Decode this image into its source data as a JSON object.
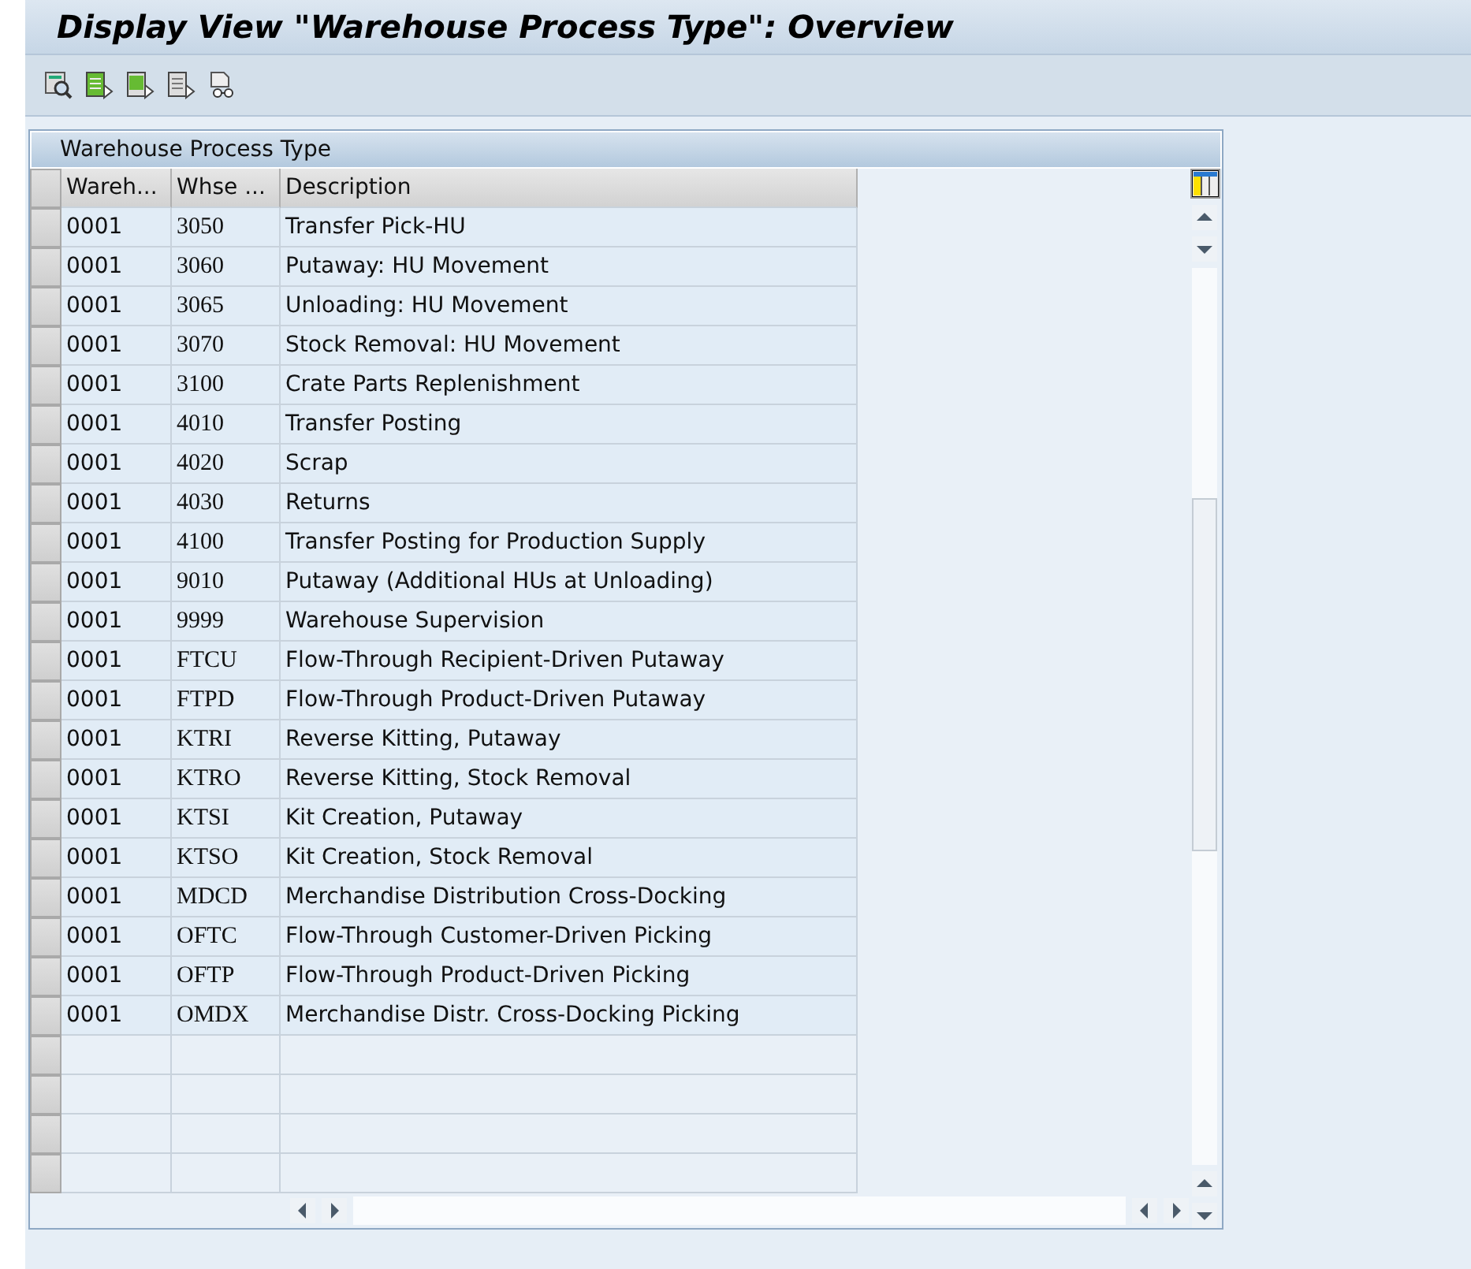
{
  "window": {
    "title": "Display View \"Warehouse Process Type\": Overview"
  },
  "toolbar": {
    "buttons": [
      {
        "kind": "find"
      },
      {
        "kind": "select-all"
      },
      {
        "kind": "select-block"
      },
      {
        "kind": "deselect"
      },
      {
        "kind": "print"
      }
    ]
  },
  "table": {
    "title": "Warehouse Process Type",
    "columns": [
      "Wareh...",
      "Whse ...",
      "Description"
    ],
    "rows": [
      [
        "0001",
        "3050",
        "Transfer Pick-HU"
      ],
      [
        "0001",
        "3060",
        "Putaway: HU Movement"
      ],
      [
        "0001",
        "3065",
        "Unloading: HU Movement"
      ],
      [
        "0001",
        "3070",
        "Stock Removal: HU Movement"
      ],
      [
        "0001",
        "3100",
        "Crate Parts Replenishment"
      ],
      [
        "0001",
        "4010",
        "Transfer Posting"
      ],
      [
        "0001",
        "4020",
        "Scrap"
      ],
      [
        "0001",
        "4030",
        "Returns"
      ],
      [
        "0001",
        "4100",
        "Transfer Posting for Production Supply"
      ],
      [
        "0001",
        "9010",
        "Putaway (Additional HUs at Unloading)"
      ],
      [
        "0001",
        "9999",
        "Warehouse Supervision"
      ],
      [
        "0001",
        "FTCU",
        "Flow-Through Recipient-Driven Putaway"
      ],
      [
        "0001",
        "FTPD",
        "Flow-Through Product-Driven Putaway"
      ],
      [
        "0001",
        "KTRI",
        "Reverse Kitting, Putaway"
      ],
      [
        "0001",
        "KTRO",
        "Reverse Kitting, Stock Removal"
      ],
      [
        "0001",
        "KTSI",
        "Kit Creation, Putaway"
      ],
      [
        "0001",
        "KTSO",
        "Kit Creation, Stock Removal"
      ],
      [
        "0001",
        "MDCD",
        "Merchandise Distribution Cross-Docking"
      ],
      [
        "0001",
        "OFTC",
        "Flow-Through Customer-Driven Picking"
      ],
      [
        "0001",
        "OFTP",
        "Flow-Through Product-Driven Picking"
      ],
      [
        "0001",
        "OMDX",
        "Merchandise Distr. Cross-Docking Picking"
      ]
    ]
  }
}
